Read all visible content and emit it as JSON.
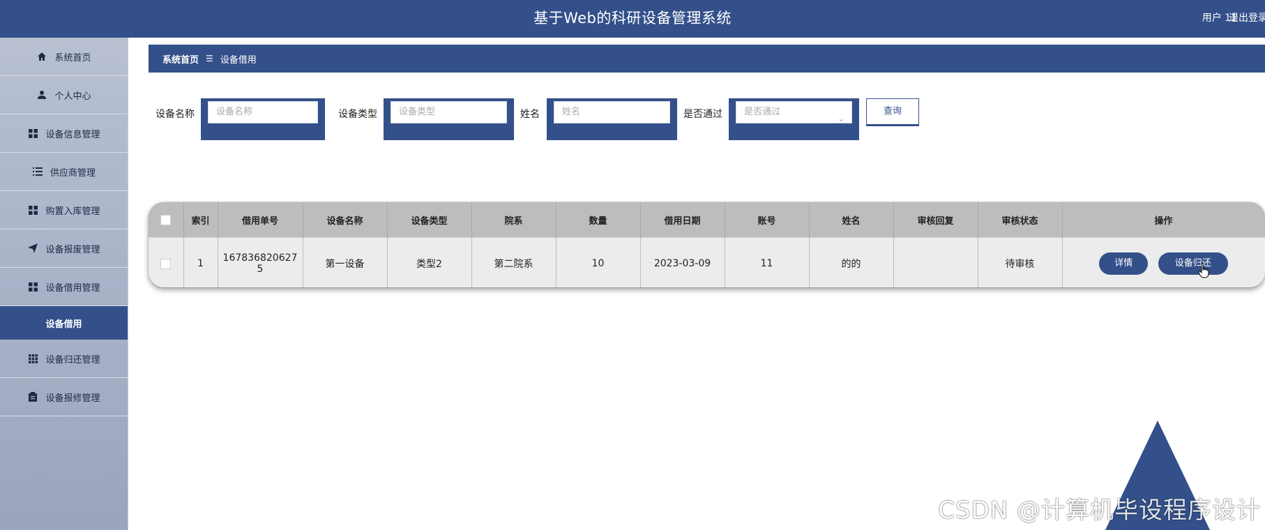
{
  "header": {
    "title": "基于Web的科研设备管理系统",
    "user": "用户 11",
    "logout": "退出登录"
  },
  "sidebar": {
    "items": [
      {
        "label": "系统首页",
        "icon": "home-icon"
      },
      {
        "label": "个人中心",
        "icon": "person-icon"
      },
      {
        "label": "设备信息管理",
        "icon": "grid-icon"
      },
      {
        "label": "供应商管理",
        "icon": "list-icon"
      },
      {
        "label": "购置入库管理",
        "icon": "grid-icon"
      },
      {
        "label": "设备报废管理",
        "icon": "send-icon"
      },
      {
        "label": "设备借用管理",
        "icon": "grid-icon"
      }
    ],
    "active_sub": "设备借用",
    "items_after": [
      {
        "label": "设备归还管理",
        "icon": "apps-icon"
      },
      {
        "label": "设备报修管理",
        "icon": "clipboard-icon"
      }
    ]
  },
  "breadcrumb": {
    "home": "系统首页",
    "separator": "☰",
    "current": "设备借用"
  },
  "search": {
    "name_label": "设备名称",
    "name_placeholder": "设备名称",
    "type_label": "设备类型",
    "type_placeholder": "设备类型",
    "person_label": "姓名",
    "person_placeholder": "姓名",
    "pass_label": "是否通过",
    "pass_placeholder": "是否通过",
    "query_button": "查询"
  },
  "table": {
    "headers": [
      "索引",
      "借用单号",
      "设备名称",
      "设备类型",
      "院系",
      "数量",
      "借用日期",
      "账号",
      "姓名",
      "审核回复",
      "审核状态",
      "操作"
    ],
    "rows": [
      {
        "index": "1",
        "order_no_line1": "167836820627",
        "order_no_line2": "5",
        "device_name": "第一设备",
        "device_type": "类型2",
        "department": "第二院系",
        "quantity": "10",
        "borrow_date": "2023-03-09",
        "account": "11",
        "name": "的的",
        "review_reply": "",
        "review_status": "待审核",
        "detail_button": "详情",
        "return_button": "设备归还"
      }
    ]
  },
  "watermark": "CSDN @计算机毕设程序设计",
  "colors": {
    "primary": "#33508a",
    "sidebar": "#b8c0d2",
    "table_header": "#bdbdbd",
    "table_row": "#ececec"
  }
}
